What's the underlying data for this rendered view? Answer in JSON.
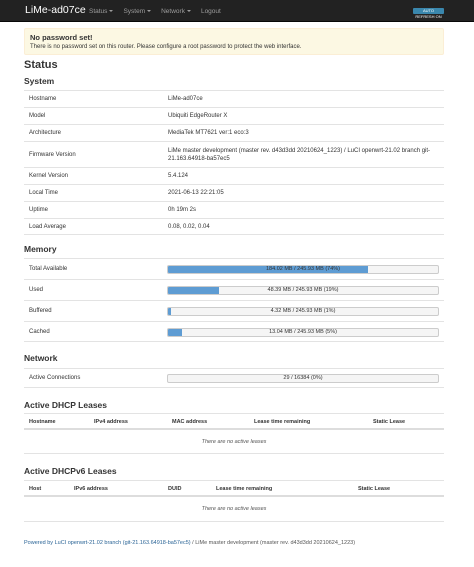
{
  "navbar": {
    "brand": "LiMe-ad07ce",
    "menu": [
      "Status",
      "System",
      "Network",
      "Logout"
    ],
    "badge": "AUTO REFRESH ON"
  },
  "alert": {
    "title": "No password set!",
    "text": "There is no password set on this router. Please configure a root password to protect the web interface."
  },
  "page_title": "Status",
  "system": {
    "title": "System",
    "rows": [
      {
        "label": "Hostname",
        "value": "LiMe-ad07ce"
      },
      {
        "label": "Model",
        "value": "Ubiquiti EdgeRouter X"
      },
      {
        "label": "Architecture",
        "value": "MediaTek MT7621 ver:1 eco:3"
      },
      {
        "label": "Firmware Version",
        "value": "LiMe master development (master rev. d43d3dd 20210624_1223) / LuCI openwrt-21.02 branch git-21.163.64918-ba57ec5"
      },
      {
        "label": "Kernel Version",
        "value": "5.4.124"
      },
      {
        "label": "Local Time",
        "value": "2021-06-13 22:21:05"
      },
      {
        "label": "Uptime",
        "value": "0h 19m 2s"
      },
      {
        "label": "Load Average",
        "value": "0.08, 0.02, 0.04"
      }
    ]
  },
  "memory": {
    "title": "Memory",
    "rows": [
      {
        "label": "Total Available",
        "text": "184.02 MB / 245.93 MB (74%)",
        "fraction": 0.74
      },
      {
        "label": "Used",
        "text": "48.39 MB / 245.93 MB (19%)",
        "fraction": 0.19
      },
      {
        "label": "Buffered",
        "text": "4.32 MB / 245.93 MB (1%)",
        "fraction": 0.01
      },
      {
        "label": "Cached",
        "text": "13.04 MB / 245.93 MB (5%)",
        "fraction": 0.05
      }
    ]
  },
  "network": {
    "title": "Network",
    "rows": [
      {
        "label": "Active Connections",
        "text": "29 / 16384 (0%)",
        "fraction": 0.0
      }
    ]
  },
  "dhcp": {
    "title": "Active DHCP Leases",
    "headers": [
      "Hostname",
      "IPv4 address",
      "MAC address",
      "Lease time remaining",
      "Static Lease"
    ],
    "empty": "There are no active leases"
  },
  "dhcp6": {
    "title": "Active DHCPv6 Leases",
    "headers": [
      "Host",
      "IPv6 address",
      "DUID",
      "Lease time remaining",
      "Static Lease"
    ],
    "empty": "There are no active leases"
  },
  "footer": {
    "link": "Powered by LuCI openwrt-21.02 branch (git-21.163.64918-ba57ec5)",
    "text": " / LiMe master development (master rev. d43d3dd 20210624_1223)"
  },
  "colors": {
    "accent": "#5e9cd3",
    "navbar": "#222222",
    "alert_bg": "#fcf8e3"
  }
}
